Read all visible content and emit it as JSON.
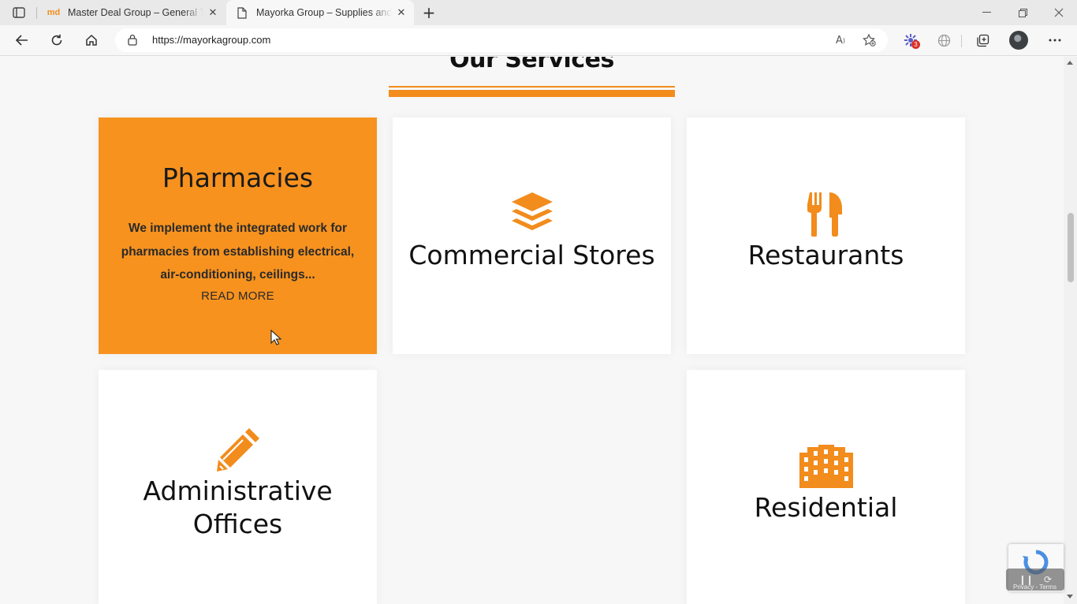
{
  "browser": {
    "tabs": [
      {
        "title": "Master Deal Group – General Tra",
        "favicon": "md"
      },
      {
        "title": "Mayorka Group – Supplies and C",
        "favicon": "page-icon"
      }
    ],
    "new_tab": "+",
    "url": "https://mayorkagroup.com",
    "extension_badge": "3"
  },
  "page": {
    "section_title": "Our Services",
    "accent_color": "#f7921e",
    "services": [
      {
        "name": "Pharmacies",
        "active": true,
        "description": "We implement the integrated work for pharmacies from establishing electrical, air-conditioning, ceilings...",
        "read_more": "READ MORE"
      },
      {
        "name": "Commercial Stores",
        "icon": "layers-icon"
      },
      {
        "name": "Restaurants",
        "icon": "utensils-icon"
      },
      {
        "name": "Administrative Offices",
        "icon": "pencil-icon"
      },
      {
        "name": "Residential",
        "icon": "building-icon"
      }
    ]
  },
  "recaptcha": {
    "links": "Privacy - Terms"
  }
}
